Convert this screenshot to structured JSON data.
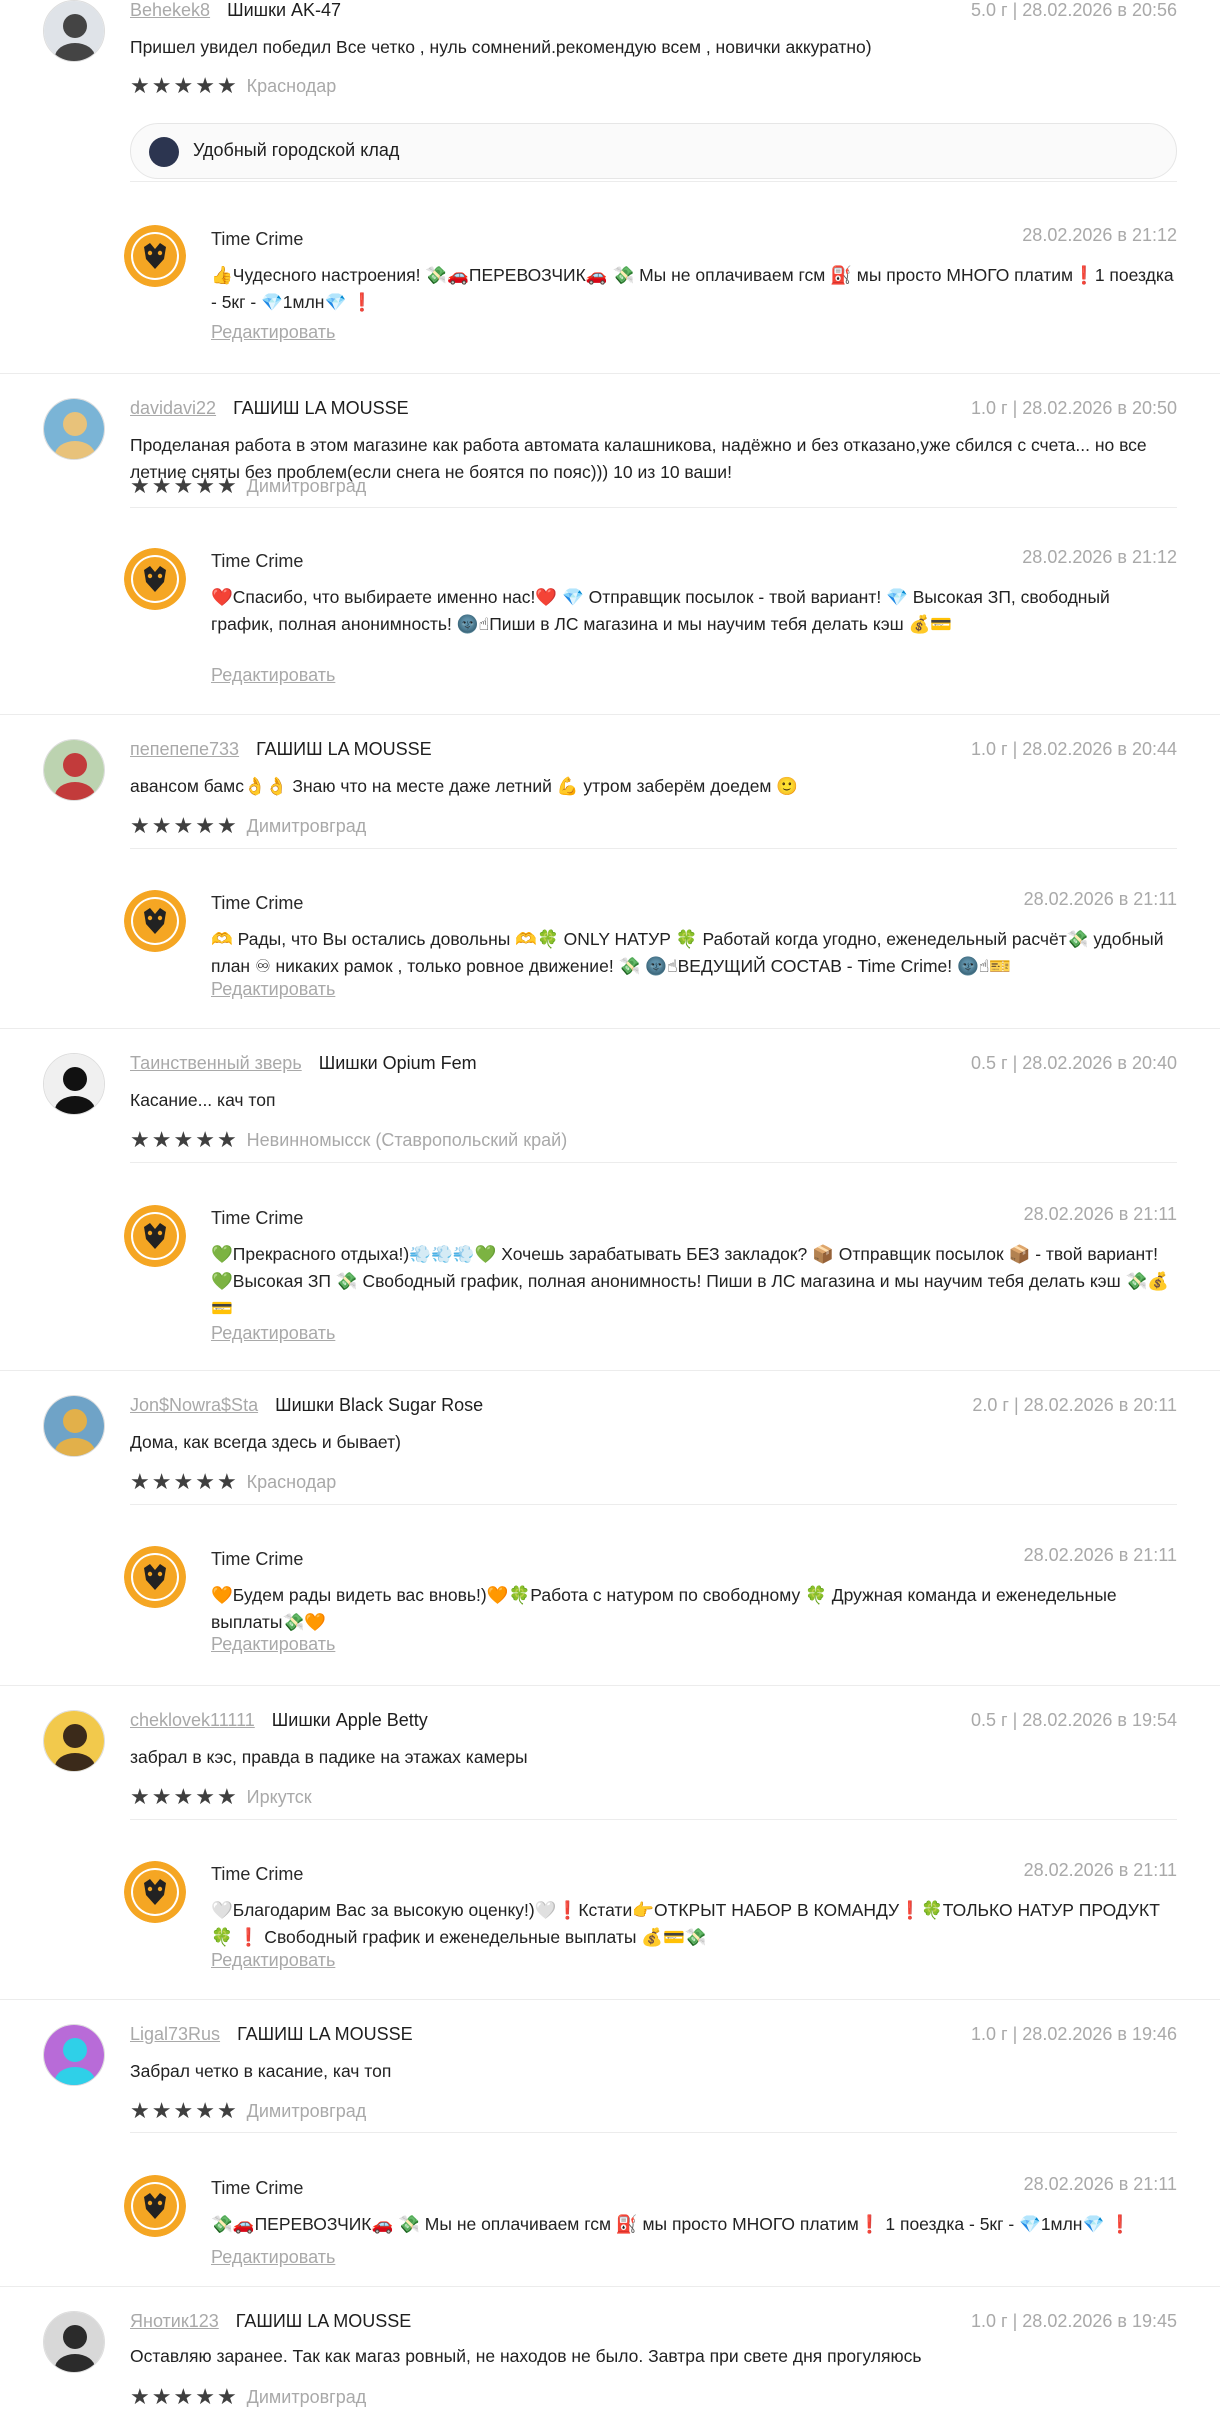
{
  "edit_label": "Редактировать",
  "colors": {
    "stars": "#3f3f3f",
    "muted": "#a9a9a9",
    "shop_logo": "#f5a623"
  },
  "reviews": [
    {
      "user": "Behekek8",
      "product": "Шишки AK-47",
      "meta": "5.0 г | 28.02.2026 в 20:56",
      "text": "Пришел увидел победил Все четко , нуль сомнений.рекомендую всем , новички аккуратно)",
      "city": "Краснодар",
      "pill": "Удобный городской клад",
      "reply": {
        "shop": "Time Crime",
        "time": "28.02.2026 в 21:12",
        "text": "👍Чудесного настроения! 💸🚗ПЕРЕВОЗЧИК🚗 💸 Мы не оплачиваем гсм ⛽ мы просто МНОГО платим❗1 поездка - 5кг - 💎1млн💎 ❗"
      }
    },
    {
      "user": "davidavi22",
      "product": "ГАШИШ LA MOUSSE",
      "meta": "1.0 г | 28.02.2026 в 20:50",
      "text": "Проделаная работа в этом магазине как работа автомата калашникова, надёжно и без отказано,уже сбился с счета... но все летние сняты без проблем(если снега не боятся по пояс))) 10 из 10 ваши!",
      "city": "Димитровград",
      "reply": {
        "shop": "Time Crime",
        "time": "28.02.2026 в 21:12",
        "text": "❤️Спасибо, что выбираете именно нас!❤️ 💎 Отправщик посылок - твой вариант! 💎 Высокая ЗП, свободный график, полная анонимность! 🌚☝Пиши в ЛС магазина и мы научим тебя делать кэш 💰💳"
      }
    },
    {
      "user": "пепепепе733",
      "product": "ГАШИШ LA MOUSSE",
      "meta": "1.0 г | 28.02.2026 в 20:44",
      "text": "авансом бамс👌👌 Знаю что на месте даже летний 💪 утром заберём доедем 🙂",
      "city": "Димитровград",
      "reply": {
        "shop": "Time Crime",
        "time": "28.02.2026 в 21:11",
        "text": "🫶 Рады, что Вы остались довольны 🫶🍀 ONLY НАТУР 🍀 Работай когда угодно, еженедельный расчёт💸 удобный план ♾ никаких рамок , только ровное движение! 💸 🌚☝ВЕДУЩИЙ СОСТАВ - Time Crime! 🌚☝🎫"
      }
    },
    {
      "user": "Таинственный зверь",
      "product": "Шишки Opium Fem",
      "meta": "0.5 г | 28.02.2026 в 20:40",
      "text": "Касание... кач топ",
      "city": "Невинномысск (Ставропольский край)",
      "reply": {
        "shop": "Time Crime",
        "time": "28.02.2026 в 21:11",
        "text": "💚Прекрасного отдыха!)💨💨💨💚 Хочешь зарабатывать БЕЗ закладок? 📦 Отправщик посылок 📦 - твой вариант!💚Высокая ЗП 💸 Свободный график, полная анонимность! Пиши в ЛС магазина и мы научим тебя делать кэш 💸💰💳"
      }
    },
    {
      "user": "Jon$Nowra$Sta",
      "product": "Шишки Black Sugar Rose",
      "meta": "2.0 г | 28.02.2026 в 20:11",
      "text": "Дома, как всегда здесь и бывает)",
      "city": "Краснодар",
      "reply": {
        "shop": "Time Crime",
        "time": "28.02.2026 в 21:11",
        "text": "🧡Будем рады видеть вас вновь!)🧡🍀Работа с натуром по свободному 🍀 Дружная команда и еженедельные выплаты💸🧡"
      }
    },
    {
      "user": "cheklovek11111",
      "product": "Шишки Apple Betty",
      "meta": "0.5 г | 28.02.2026 в 19:54",
      "text": "забрал в кэс, правда в падике на этажах камеры",
      "city": "Иркутск",
      "reply": {
        "shop": "Time Crime",
        "time": "28.02.2026 в 21:11",
        "text": "🤍Благодарим Вас за высокую оценку!)🤍❗Кстати👉ОТКРЫТ НАБОР В КОМАНДУ❗🍀ТОЛЬКО НАТУР ПРОДУКТ🍀 ❗ Свободный график и еженедельные выплаты 💰💳💸"
      }
    },
    {
      "user": "Ligal73Rus",
      "product": "ГАШИШ LA MOUSSE",
      "meta": "1.0 г | 28.02.2026 в 19:46",
      "text": "Забрал четко в касание, кач топ",
      "city": "Димитровград",
      "reply": {
        "shop": "Time Crime",
        "time": "28.02.2026 в 21:11",
        "text": "💸🚗ПЕРЕВОЗЧИК🚗 💸 Мы не оплачиваем гсм ⛽ мы просто МНОГО платим❗ 1 поездка - 5кг - 💎1млн💎 ❗"
      }
    },
    {
      "user": "Янотик123",
      "product": "ГАШИШ LA MOUSSE",
      "meta": "1.0 г | 28.02.2026 в 19:45",
      "text": "Оставляю заранее. Так как магаз ровный, не находов не было. Завтра при свете дня прогуляюсь",
      "city": "Димитровград"
    }
  ]
}
